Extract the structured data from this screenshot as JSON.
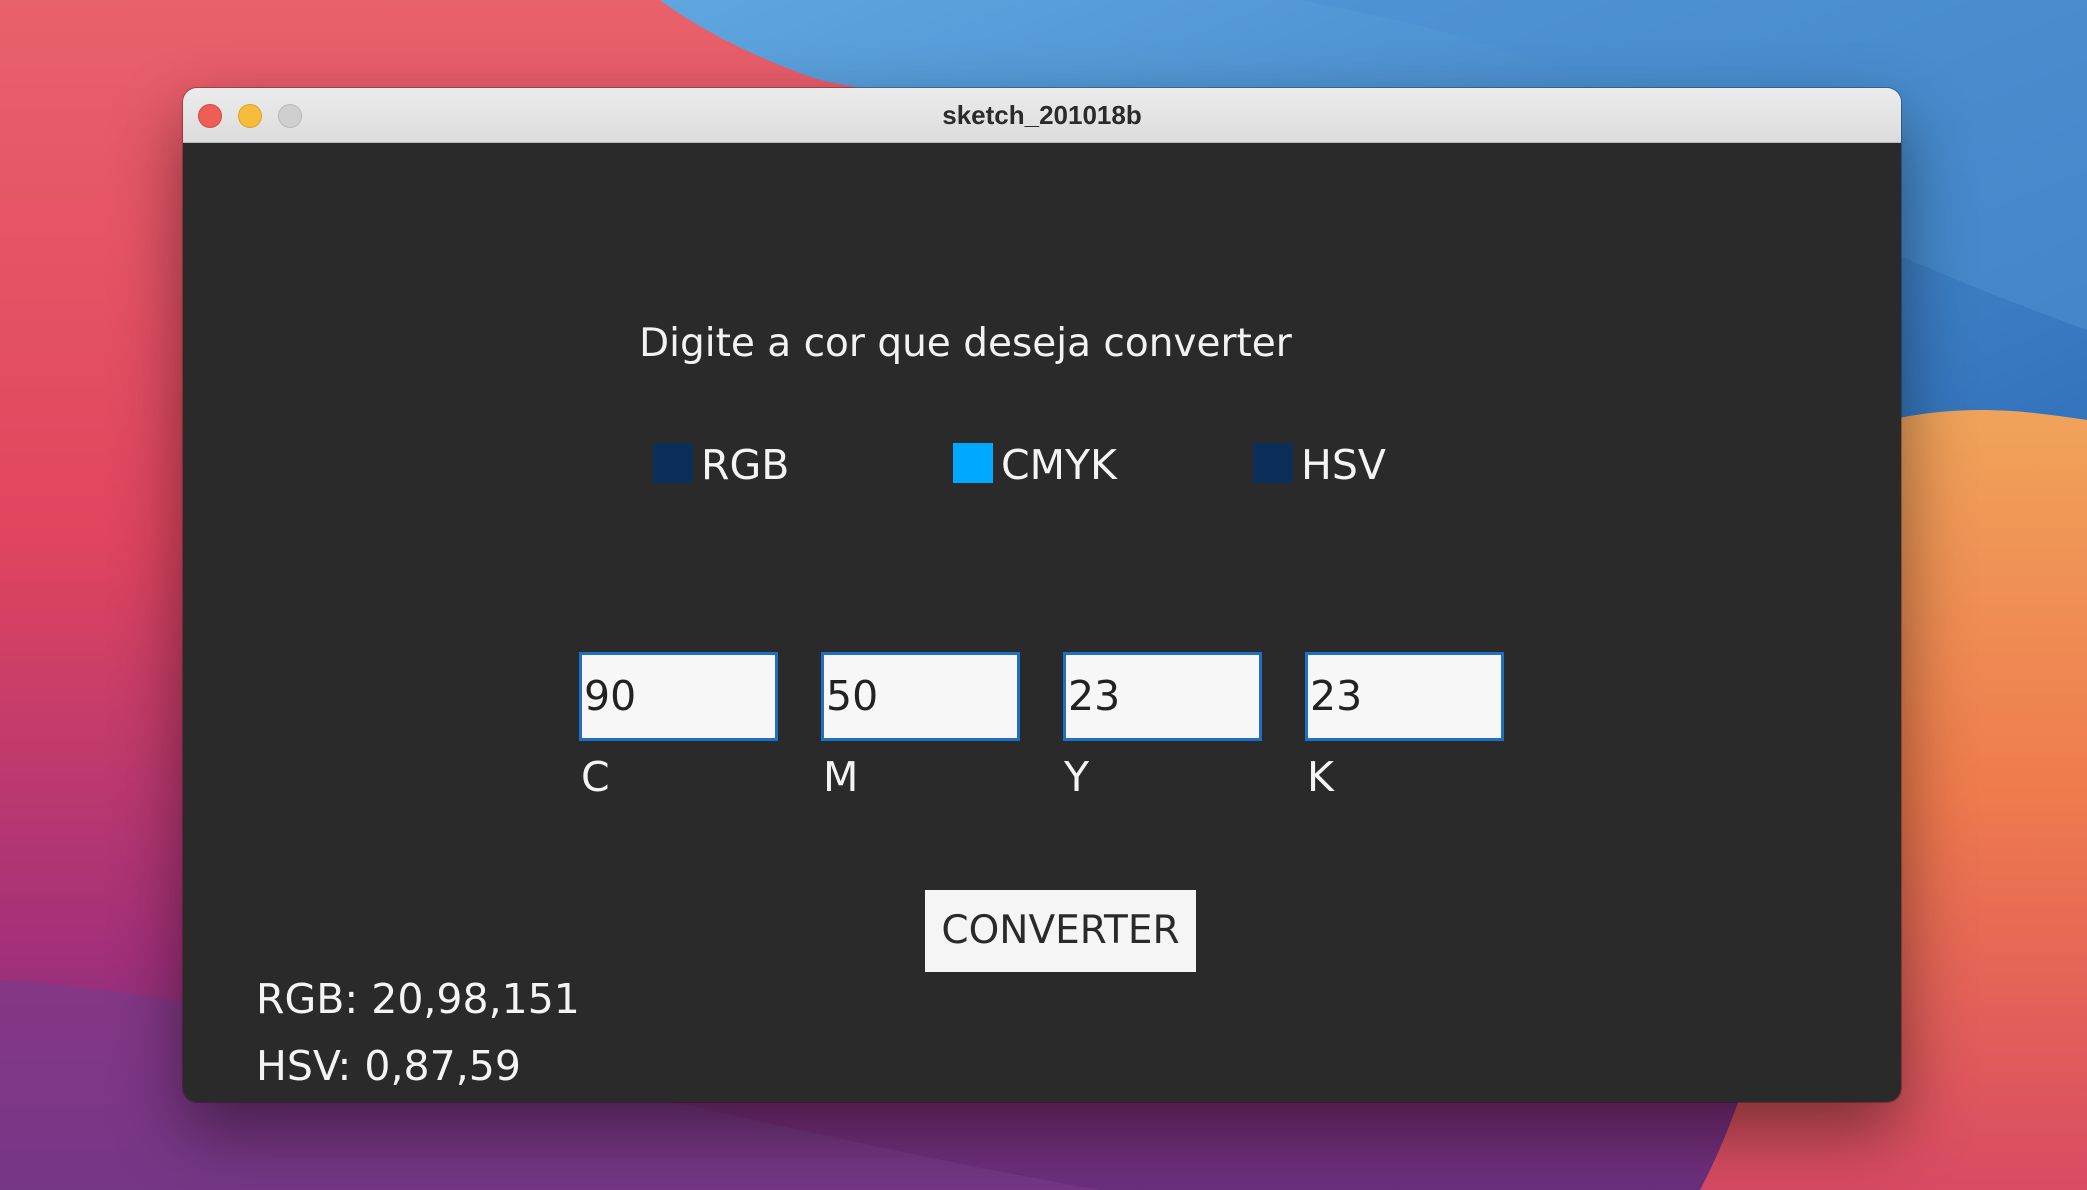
{
  "window": {
    "title": "sketch_201018b",
    "buttons": [
      "close",
      "minimize",
      "zoom"
    ]
  },
  "app": {
    "heading": "Digite a cor que deseja converter",
    "color_modes": [
      {
        "label": "RGB",
        "color": "#0c2f5a",
        "selected": false
      },
      {
        "label": "CMYK",
        "color": "#00a8ff",
        "selected": true
      },
      {
        "label": "HSV",
        "color": "#0c2f5a",
        "selected": false
      }
    ],
    "inputs": [
      {
        "label": "C",
        "value": "90"
      },
      {
        "label": "M",
        "value": "50"
      },
      {
        "label": "Y",
        "value": "23"
      },
      {
        "label": "K",
        "value": "23"
      }
    ],
    "convert_label": "CONVERTER",
    "results": {
      "rgb": "RGB: 20,98,151",
      "hsv": "HSV: 0,87,59"
    },
    "canvas_bg": "#2a2a2a",
    "status_bar_color": "#13609a"
  }
}
